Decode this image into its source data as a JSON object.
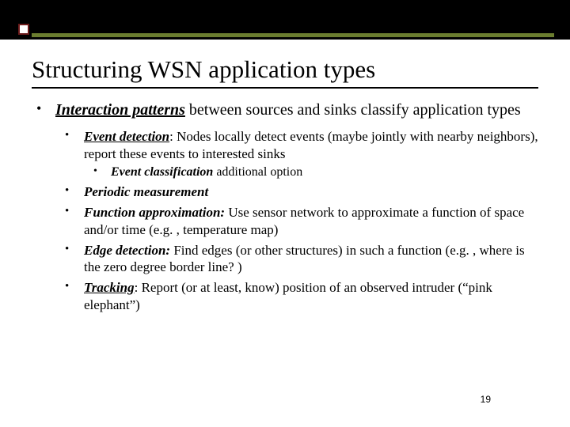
{
  "slide": {
    "title": "Structuring WSN application types",
    "main": {
      "lead_bold": "Interaction patterns",
      "lead_rest": " between sources and sinks classify application types"
    },
    "items": [
      {
        "term": "Event detection",
        "sep": ": ",
        "desc": "Nodes locally detect events (maybe jointly with nearby neighbors), report these events to interested sinks",
        "sub": {
          "term": "Event classification",
          "rest": " additional option"
        }
      },
      {
        "term": "Periodic measurement",
        "sep": "",
        "desc": ""
      },
      {
        "term": "Function approximation:",
        "sep": " ",
        "desc": "Use sensor network to approximate a function of space and/or time (e.g. , temperature map)"
      },
      {
        "term": "Edge detection:",
        "sep": " ",
        "desc": "Find edges (or other structures) in such a function (e.g. , where is the zero degree border line? )"
      },
      {
        "term": "Tracking",
        "sep": ": ",
        "desc": "Report (or at least, know) position of an observed intruder (“pink elephant”)"
      }
    ],
    "page_number": "19"
  }
}
